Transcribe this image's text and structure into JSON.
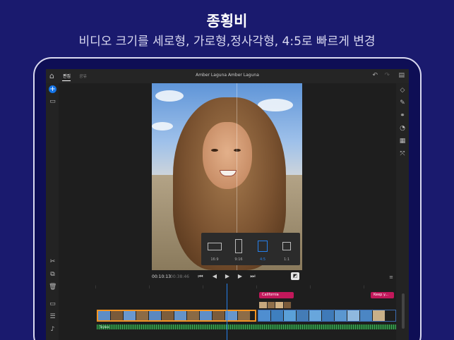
{
  "promo": {
    "headline": "종횡비",
    "subline": "비디오 크기를 세로형, 가로형,정사각형, 4:5로 빠르게 변경"
  },
  "app": {
    "tabs": [
      {
        "label": "편집",
        "active": true
      },
      {
        "label": "공유",
        "active": false
      }
    ],
    "project_title": "Amber Laguna  Amber Laguna"
  },
  "aspect_ratio": {
    "options": [
      {
        "label": "16:9",
        "selected": false
      },
      {
        "label": "9:16",
        "selected": false
      },
      {
        "label": "4:5",
        "selected": true
      },
      {
        "label": "1:1",
        "selected": false
      }
    ]
  },
  "playback": {
    "current_time": "00:10:13",
    "total_time": "00:38:46"
  },
  "timeline": {
    "title_clips": [
      "California",
      "Keep y..."
    ],
    "audio_track_label": "Toybox"
  },
  "colors": {
    "background": "#1a1a6e",
    "accent_blue": "#2680eb",
    "clip_selected": "#f29423",
    "title_clip": "#c2185b",
    "audio_track": "#1f5e2a"
  },
  "icons": {
    "top": [
      "home-icon",
      "undo-icon",
      "redo-icon",
      "comment-icon"
    ],
    "left": [
      "add-media-icon",
      "trash-icon",
      "split-icon",
      "duplicate-icon",
      "delete-icon",
      "track-icon",
      "list-icon",
      "audio-icon"
    ],
    "right": [
      "shape-icon",
      "color-icon",
      "effects-icon",
      "speed-icon",
      "crop-icon",
      "transform-icon"
    ]
  }
}
